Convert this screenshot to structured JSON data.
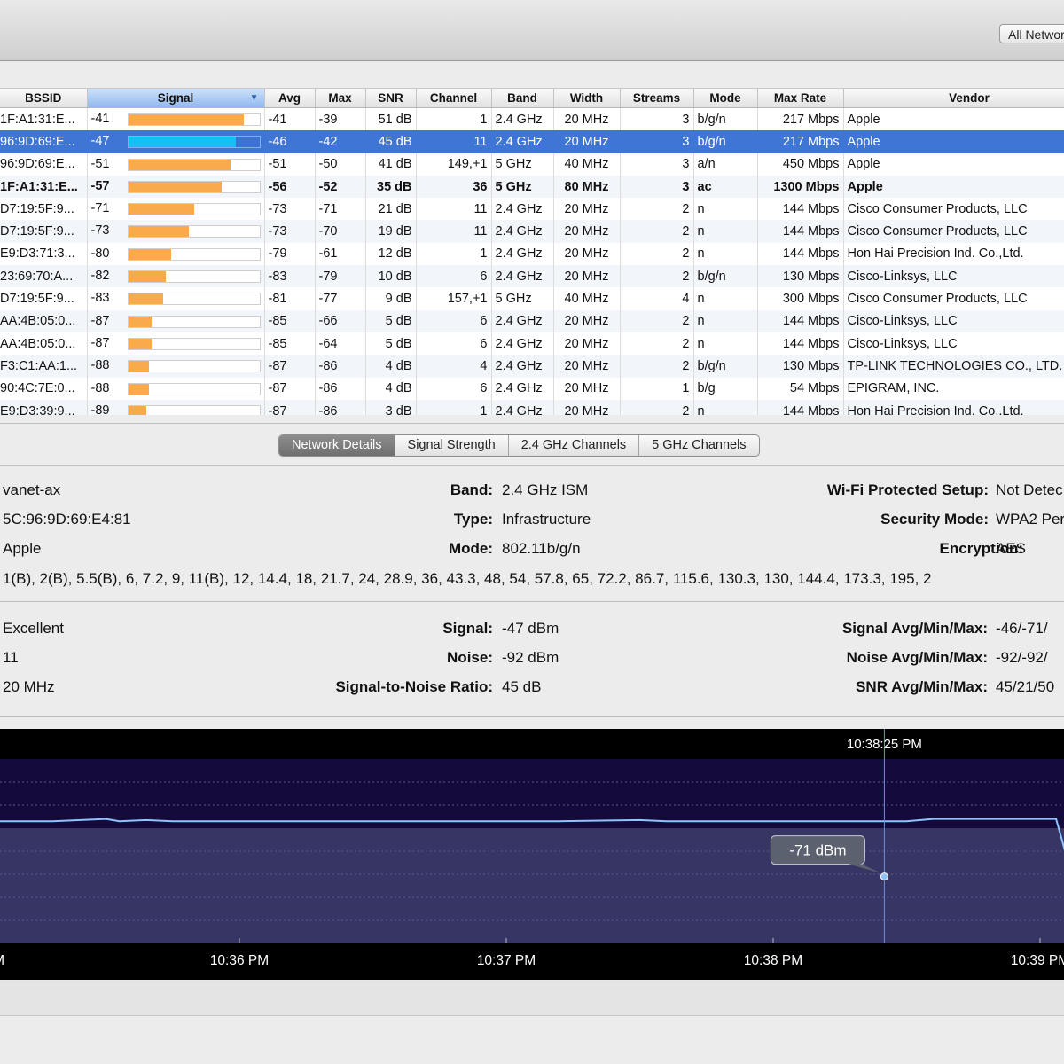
{
  "toolbar": {
    "filter_button": "All Networks"
  },
  "table": {
    "columns": [
      "BSSID",
      "Signal",
      "Avg",
      "Max",
      "SNR",
      "Channel",
      "Band",
      "Width",
      "Streams",
      "Mode",
      "Max Rate",
      "Vendor"
    ],
    "sorted_column": "Signal",
    "rows": [
      {
        "bssid": "1F:A1:31:E...",
        "signal": "-41",
        "signal_pct": 0.88,
        "avg": "-41",
        "max": "-39",
        "snr": "51 dB",
        "channel": "1",
        "band": "2.4 GHz",
        "width": "20 MHz",
        "streams": "3",
        "mode": "b/g/n",
        "rate": "217 Mbps",
        "vendor": "Apple",
        "style": "normal"
      },
      {
        "bssid": "96:9D:69:E...",
        "signal": "-47",
        "signal_pct": 0.82,
        "avg": "-46",
        "max": "-42",
        "snr": "45 dB",
        "channel": "11",
        "band": "2.4 GHz",
        "width": "20 MHz",
        "streams": "3",
        "mode": "b/g/n",
        "rate": "217 Mbps",
        "vendor": "Apple",
        "style": "selected"
      },
      {
        "bssid": "96:9D:69:E...",
        "signal": "-51",
        "signal_pct": 0.78,
        "avg": "-51",
        "max": "-50",
        "snr": "41 dB",
        "channel": "149,+1",
        "band": "5 GHz",
        "width": "40 MHz",
        "streams": "3",
        "mode": "a/n",
        "rate": "450 Mbps",
        "vendor": "Apple",
        "style": "normal"
      },
      {
        "bssid": "1F:A1:31:E...",
        "signal": "-57",
        "signal_pct": 0.71,
        "avg": "-56",
        "max": "-52",
        "snr": "35 dB",
        "channel": "36",
        "band": "5 GHz",
        "width": "80 MHz",
        "streams": "3",
        "mode": "ac",
        "rate": "1300 Mbps",
        "vendor": "Apple",
        "style": "bold"
      },
      {
        "bssid": "D7:19:5F:9...",
        "signal": "-71",
        "signal_pct": 0.5,
        "avg": "-73",
        "max": "-71",
        "snr": "21 dB",
        "channel": "11",
        "band": "2.4 GHz",
        "width": "20 MHz",
        "streams": "2",
        "mode": "n",
        "rate": "144 Mbps",
        "vendor": "Cisco Consumer Products, LLC",
        "style": "normal"
      },
      {
        "bssid": "D7:19:5F:9...",
        "signal": "-73",
        "signal_pct": 0.46,
        "avg": "-73",
        "max": "-70",
        "snr": "19 dB",
        "channel": "11",
        "band": "2.4 GHz",
        "width": "20 MHz",
        "streams": "2",
        "mode": "n",
        "rate": "144 Mbps",
        "vendor": "Cisco Consumer Products, LLC",
        "style": "normal"
      },
      {
        "bssid": "E9:D3:71:3...",
        "signal": "-80",
        "signal_pct": 0.33,
        "avg": "-79",
        "max": "-61",
        "snr": "12 dB",
        "channel": "1",
        "band": "2.4 GHz",
        "width": "20 MHz",
        "streams": "2",
        "mode": "n",
        "rate": "144 Mbps",
        "vendor": "Hon Hai Precision Ind. Co.,Ltd.",
        "style": "normal"
      },
      {
        "bssid": "23:69:70:A...",
        "signal": "-82",
        "signal_pct": 0.29,
        "avg": "-83",
        "max": "-79",
        "snr": "10 dB",
        "channel": "6",
        "band": "2.4 GHz",
        "width": "20 MHz",
        "streams": "2",
        "mode": "b/g/n",
        "rate": "130 Mbps",
        "vendor": "Cisco-Linksys, LLC",
        "style": "normal"
      },
      {
        "bssid": "D7:19:5F:9...",
        "signal": "-83",
        "signal_pct": 0.27,
        "avg": "-81",
        "max": "-77",
        "snr": "9 dB",
        "channel": "157,+1",
        "band": "5 GHz",
        "width": "40 MHz",
        "streams": "4",
        "mode": "n",
        "rate": "300 Mbps",
        "vendor": "Cisco Consumer Products, LLC",
        "style": "normal"
      },
      {
        "bssid": "AA:4B:05:0...",
        "signal": "-87",
        "signal_pct": 0.18,
        "avg": "-85",
        "max": "-66",
        "snr": "5 dB",
        "channel": "6",
        "band": "2.4 GHz",
        "width": "20 MHz",
        "streams": "2",
        "mode": "n",
        "rate": "144 Mbps",
        "vendor": "Cisco-Linksys, LLC",
        "style": "normal"
      },
      {
        "bssid": "AA:4B:05:0...",
        "signal": "-87",
        "signal_pct": 0.18,
        "avg": "-85",
        "max": "-64",
        "snr": "5 dB",
        "channel": "6",
        "band": "2.4 GHz",
        "width": "20 MHz",
        "streams": "2",
        "mode": "n",
        "rate": "144 Mbps",
        "vendor": "Cisco-Linksys, LLC",
        "style": "normal"
      },
      {
        "bssid": "F3:C1:AA:1...",
        "signal": "-88",
        "signal_pct": 0.16,
        "avg": "-87",
        "max": "-86",
        "snr": "4 dB",
        "channel": "4",
        "band": "2.4 GHz",
        "width": "20 MHz",
        "streams": "2",
        "mode": "b/g/n",
        "rate": "130 Mbps",
        "vendor": "TP-LINK TECHNOLOGIES CO., LTD.",
        "style": "normal"
      },
      {
        "bssid": "90:4C:7E:0...",
        "signal": "-88",
        "signal_pct": 0.16,
        "avg": "-87",
        "max": "-86",
        "snr": "4 dB",
        "channel": "6",
        "band": "2.4 GHz",
        "width": "20 MHz",
        "streams": "1",
        "mode": "b/g",
        "rate": "54 Mbps",
        "vendor": "EPIGRAM, INC.",
        "style": "normal"
      },
      {
        "bssid": "E9:D3:39:9...",
        "signal": "-89",
        "signal_pct": 0.14,
        "avg": "-87",
        "max": "-86",
        "snr": "3 dB",
        "channel": "1",
        "band": "2.4 GHz",
        "width": "20 MHz",
        "streams": "2",
        "mode": "n",
        "rate": "144 Mbps",
        "vendor": "Hon Hai Precision Ind. Co.,Ltd.",
        "style": "normal"
      }
    ]
  },
  "tabs": [
    "Network Details",
    "Signal Strength",
    "2.4 GHz Channels",
    "5 GHz Channels"
  ],
  "active_tab": "Network Details",
  "details": {
    "name": "vanet-ax",
    "bssid": "5C:96:9D:69:E4:81",
    "vendor": "Apple",
    "rates": "1(B), 2(B), 5.5(B), 6, 7.2, 9, 11(B), 12, 14.4, 18, 21.7, 24, 28.9, 36, 43.3, 48, 54, 57.8, 65, 72.2, 86.7, 115.6, 130.3, 130, 144.4, 173.3, 195, 2",
    "band_label": "Band:",
    "band": "2.4 GHz ISM",
    "type_label": "Type:",
    "type": "Infrastructure",
    "mode_label": "Mode:",
    "mode": "802.11b/g/n",
    "wps_label": "Wi-Fi Protected Setup:",
    "wps": "Not Detec",
    "security_label": "Security Mode:",
    "security": "WPA2 Per",
    "encryption_label": "Encryption:",
    "encryption": "AES",
    "quality": "Excellent",
    "channel": "11",
    "width": "20 MHz",
    "signal_label": "Signal:",
    "signal": "-47 dBm",
    "noise_label": "Noise:",
    "noise": "-92 dBm",
    "snr_label": "Signal-to-Noise Ratio:",
    "snr": "45 dB",
    "signal_stats_label": "Signal Avg/Min/Max:",
    "signal_stats": "-46/-71/",
    "noise_stats_label": "Noise Avg/Min/Max:",
    "noise_stats": "-92/-92/",
    "snr_stats_label": "SNR Avg/Min/Max:",
    "snr_stats": "45/21/50"
  },
  "chart_data": {
    "type": "line",
    "x_tick_labels": [
      "M",
      "10:36 PM",
      "10:37 PM",
      "10:38 PM",
      "10:39 PM"
    ],
    "cursor_time": "10:38:25 PM",
    "cursor_value_label": "-71 dBm",
    "series": [
      {
        "x_minutes": [
          -0.9,
          -0.7,
          -0.5,
          -0.45,
          -0.35,
          -0.25,
          -0.2,
          -0.1,
          0,
          0.2,
          0.5,
          0.8,
          1.0,
          1.2,
          1.5,
          1.6,
          1.7,
          2.0,
          2.3,
          2.5,
          2.6,
          2.8,
          2.95,
          3.0,
          3.06,
          3.12,
          3.2,
          3.5,
          3.65,
          3.8,
          3.9
        ],
        "y_dbm": [
          -47,
          -47,
          -46,
          -47,
          -46.5,
          -47,
          -47,
          -47,
          -47,
          -47,
          -47,
          -47,
          -47,
          -47,
          -46.5,
          -47,
          -47,
          -47,
          -47,
          -47,
          -46,
          -46,
          -46,
          -46,
          -46,
          -71,
          -47,
          -47,
          -47,
          -47,
          -47
        ]
      }
    ]
  },
  "colors": {
    "selection": "#3f76d6",
    "bar": "#f8aa4d",
    "bar_selected": "#14c0f5",
    "graph_line": "#8fc3ff"
  }
}
